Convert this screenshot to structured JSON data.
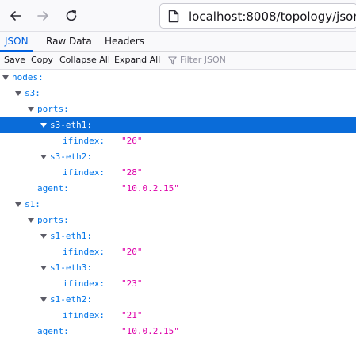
{
  "browser": {
    "url": "localhost:8008/topology/json"
  },
  "tabs": [
    {
      "label": "JSON",
      "active": true
    },
    {
      "label": "Raw Data",
      "active": false
    },
    {
      "label": "Headers",
      "active": false
    }
  ],
  "toolbar": {
    "save": "Save",
    "copy": "Copy",
    "collapse_all": "Collapse All",
    "expand_all": "Expand All",
    "filter_placeholder": "Filter JSON"
  },
  "tree": {
    "nodes": "nodes:",
    "s3": "s3:",
    "s3_ports": "ports:",
    "s3_eth1": "s3-eth1:",
    "s3_eth1_ifindex_key": "ifindex:",
    "s3_eth1_ifindex_val": "\"26\"",
    "s3_eth2": "s3-eth2:",
    "s3_eth2_ifindex_key": "ifindex:",
    "s3_eth2_ifindex_val": "\"28\"",
    "s3_agent_key": "agent:",
    "s3_agent_val": "\"10.0.2.15\"",
    "s1": "s1:",
    "s1_ports": "ports:",
    "s1_eth1": "s1-eth1:",
    "s1_eth1_ifindex_key": "ifindex:",
    "s1_eth1_ifindex_val": "\"20\"",
    "s1_eth3": "s1-eth3:",
    "s1_eth3_ifindex_key": "ifindex:",
    "s1_eth3_ifindex_val": "\"23\"",
    "s1_eth2": "s1-eth2:",
    "s1_eth2_ifindex_key": "ifindex:",
    "s1_eth2_ifindex_val": "\"21\"",
    "s1_agent_key": "agent:",
    "s1_agent_val": "\"10.0.2.15\""
  },
  "colors": {
    "accent": "#0060df",
    "selected_row": "#0a6cd9",
    "key": "#0074e8",
    "string_value": "#dd00a9"
  }
}
